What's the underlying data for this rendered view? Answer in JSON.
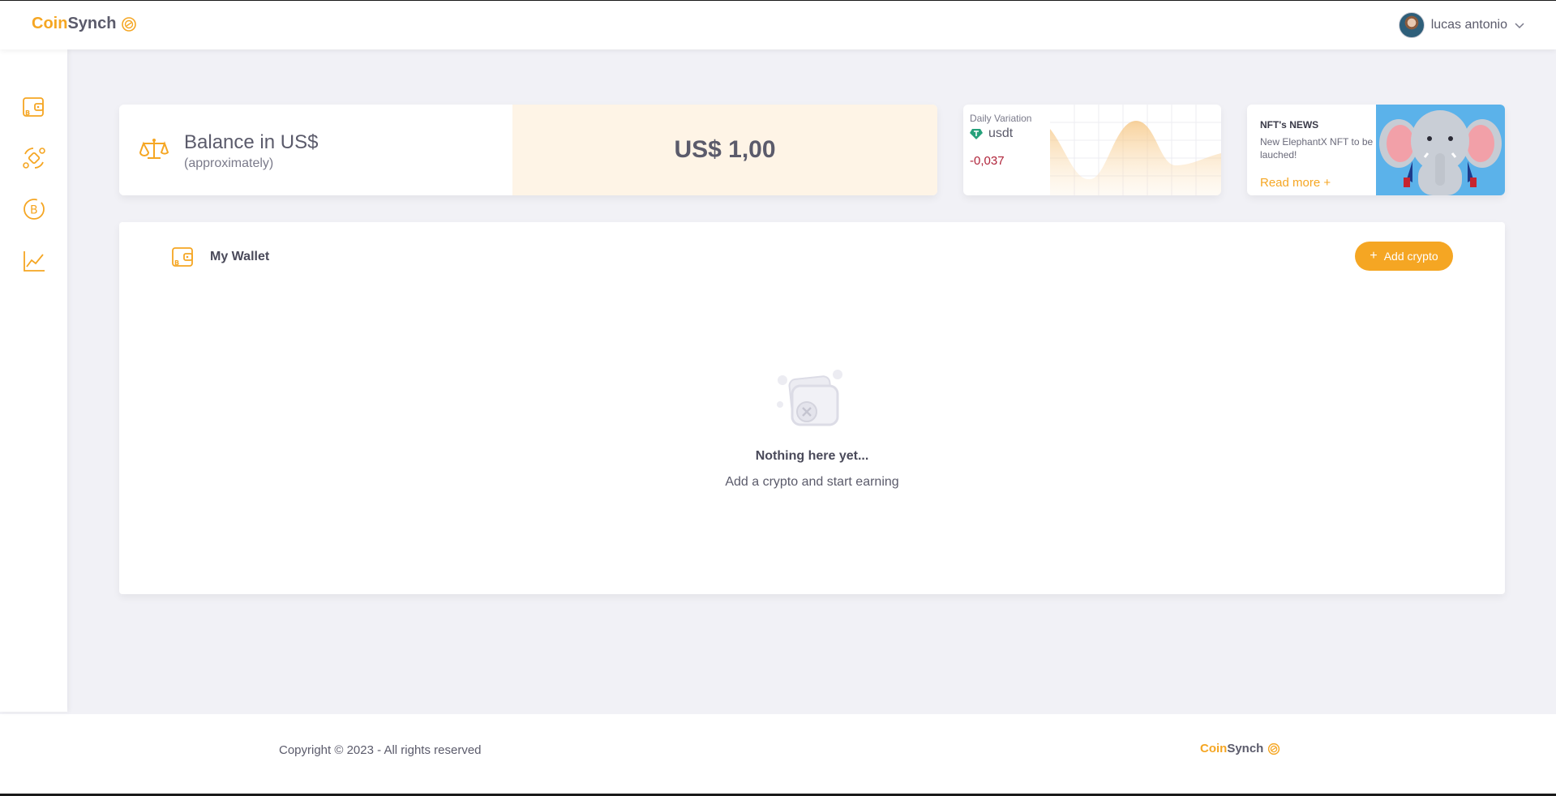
{
  "header": {
    "logo_coin": "Coin",
    "logo_synch": "Synch",
    "user_name": "lucas antonio"
  },
  "sidebar": {
    "items": [
      {
        "icon": "wallet-icon"
      },
      {
        "icon": "crypto-exchange-icon"
      },
      {
        "icon": "bitcoin-icon"
      },
      {
        "icon": "chart-line-icon"
      }
    ]
  },
  "balance": {
    "title": "Balance in US$",
    "subtitle": "(approximately)",
    "value": "US$ 1,00"
  },
  "variation": {
    "label": "Daily Variation",
    "coin": "usdt",
    "value": "-0,037"
  },
  "news": {
    "title": "NFT's NEWS",
    "text": "New ElephantX NFT to be lauched!",
    "link": "Read more +"
  },
  "wallet": {
    "title": "My Wallet",
    "add_button": "Add crypto",
    "empty_title": "Nothing here yet...",
    "empty_subtitle": "Add a crypto and start earning"
  },
  "footer": {
    "copyright": "Copyright © 2023 - All rights reserved",
    "logo_coin": "Coin",
    "logo_synch": "Synch"
  },
  "colors": {
    "accent": "#f5a623",
    "negative": "#b0243a",
    "background": "#f1f1f6"
  }
}
